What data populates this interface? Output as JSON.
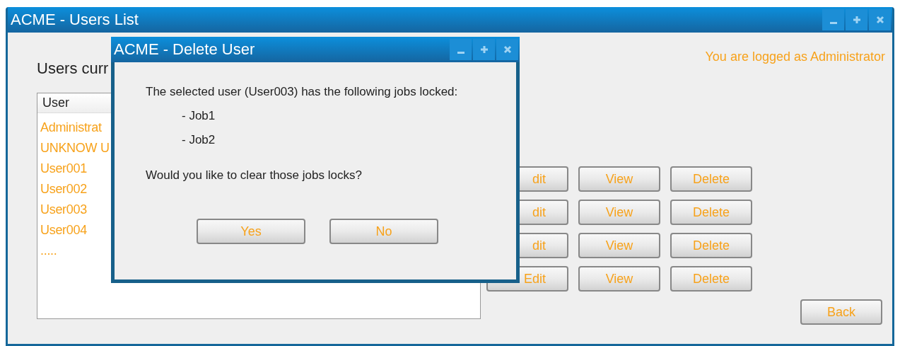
{
  "window": {
    "title": "ACME - Users List"
  },
  "heading": "Users curr",
  "login_note": "You are logged as Administrator",
  "user_list": {
    "header": "User",
    "items": [
      "Administrat",
      "UNKNOW U",
      "User001",
      "User002",
      "User003",
      "User004",
      "....."
    ]
  },
  "action_rows": [
    {
      "edit": "dit",
      "view": "View",
      "delete": "Delete"
    },
    {
      "edit": "dit",
      "view": "View",
      "delete": "Delete"
    },
    {
      "edit": "dit",
      "view": "View",
      "delete": "Delete"
    },
    {
      "edit": "Edit",
      "view": "View",
      "delete": "Delete"
    }
  ],
  "back_button": "Back",
  "dialog": {
    "title": "ACME - Delete User",
    "message": "The selected user (User003) has the following jobs locked:",
    "jobs": [
      "- Job1",
      "- Job2"
    ],
    "question": "Would you like to clear those jobs locks?",
    "buttons": [
      "Yes",
      "No"
    ]
  }
}
